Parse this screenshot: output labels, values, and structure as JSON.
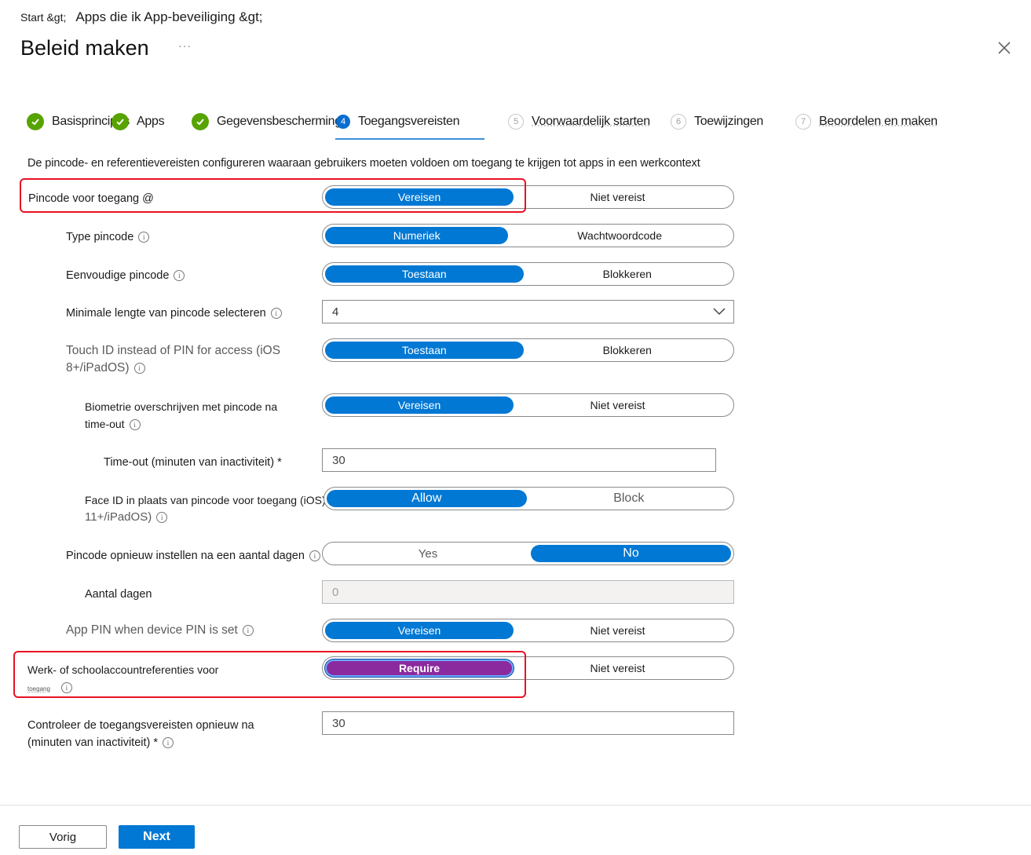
{
  "breadcrumb": {
    "item1": "Start &gt;",
    "item2": "Apps die ik App-beveiliging &gt;"
  },
  "header": {
    "title": "Beleid maken",
    "more": "···"
  },
  "tabs": [
    {
      "label": "Basisprincipes",
      "state": "done"
    },
    {
      "label": "Apps",
      "state": "done"
    },
    {
      "label": "Gegevensbescherming",
      "state": "done"
    },
    {
      "label": "Toegangsvereisten",
      "state": "current",
      "number": "4"
    },
    {
      "label": "Voorwaardelijk starten",
      "state": "pending",
      "number": "5"
    },
    {
      "label": "Toewijzingen",
      "state": "pending",
      "number": "6"
    },
    {
      "label": "Beoordelen en maken",
      "state": "pending",
      "number": "7"
    }
  ],
  "intro": "De pincode- en referentievereisten configureren waaraan gebruikers moeten voldoen om toegang te krijgen tot apps in een werkcontext",
  "settings": {
    "pin_access": {
      "label": "Pincode voor toegang @",
      "on": "Vereisen",
      "off": "Niet vereist",
      "selected": "on"
    },
    "pin_type": {
      "label": "Type pincode",
      "on": "Numeriek",
      "off": "Wachtwoordcode",
      "selected": "on"
    },
    "simple_pin": {
      "label": "Eenvoudige pincode",
      "on": "Toestaan",
      "off": "Blokkeren",
      "selected": "on"
    },
    "min_length": {
      "label": "Minimale lengte van pincode selecteren",
      "value": "4"
    },
    "touch_id": {
      "label_line1": "Touch ID instead of PIN for access (iOS",
      "label_line2": "8+/iPadOS)",
      "on": "Toestaan",
      "off": "Blokkeren",
      "selected": "on"
    },
    "biometric_override": {
      "label_line1": "Biometrie overschrijven met pincode na",
      "label_line2": "time-out",
      "on": "Vereisen",
      "off": "Niet vereist",
      "selected": "on"
    },
    "timeout": {
      "label": "Time-out (minuten van inactiviteit) *",
      "value": "30"
    },
    "face_id": {
      "label_line1": "Face ID in plaats van pincode voor toegang (iOS)",
      "label_line2": "11+/iPadOS)",
      "on": "Allow",
      "off": "Block",
      "selected": "on"
    },
    "pin_reset": {
      "label": "Pincode opnieuw instellen na een aantal dagen",
      "on": "Yes",
      "off": "No",
      "selected": "off"
    },
    "days": {
      "label": "Aantal dagen",
      "value": "0"
    },
    "app_pin_device": {
      "label": "App PIN when device PIN is set",
      "on": "Vereisen",
      "off": "Niet vereist",
      "selected": "on"
    },
    "work_credentials": {
      "label_line1": "Werk- of schoolaccountreferenties voor",
      "label_line2": "toegang",
      "on": "Require",
      "off": "Niet vereist",
      "selected": "on"
    },
    "recheck": {
      "label_line1": "Controleer de toegangsvereisten opnieuw na",
      "label_line2": "(minuten van inactiviteit) *",
      "value": "30"
    }
  },
  "footer": {
    "prev": "Vorig",
    "next": "Next"
  },
  "colors": {
    "accent": "#0078d4",
    "success": "#57a300",
    "highlight": "#e81123",
    "require_purple": "#8b2a9e"
  }
}
